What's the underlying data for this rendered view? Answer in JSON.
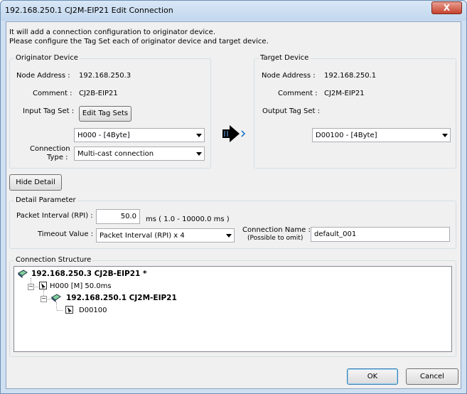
{
  "window": {
    "title": "192.168.250.1 CJ2M-EIP21 Edit Connection",
    "close_glyph": "X"
  },
  "intro": {
    "line1": "It will add a connection configuration to originator device.",
    "line2": "Please configure the Tag Set each of originator device and target device."
  },
  "originator": {
    "legend": "Originator Device",
    "node_address_label": "Node Address :",
    "node_address": "192.168.250.3",
    "comment_label": "Comment :",
    "comment": "CJ2B-EIP21",
    "input_tag_set_label": "Input Tag Set :",
    "edit_tag_sets_button": "Edit Tag Sets",
    "input_tag_set": "H000 - [4Byte]",
    "connection_type_label_1": "Connection",
    "connection_type_label_2": "Type :",
    "connection_type": "Multi-cast connection"
  },
  "target": {
    "legend": "Target Device",
    "node_address_label": "Node Address :",
    "node_address": "192.168.250.1",
    "comment_label": "Comment :",
    "comment": "CJ2M-EIP21",
    "output_tag_set_label": "Output Tag Set :",
    "output_tag_set": "D00100 - [4Byte]"
  },
  "hide_detail_button": "Hide Detail",
  "detail": {
    "legend": "Detail Parameter",
    "packet_interval_label": "Packet Interval (RPI) :",
    "packet_interval": "50.0",
    "packet_interval_range": "ms ( 1.0 - 10000.0 ms )",
    "timeout_label": "Timeout Value :",
    "timeout_value": "Packet Interval (RPI) x 4",
    "connection_name_label_1": "Connection Name :",
    "connection_name_label_2": "(Possible to omit)",
    "connection_name": "default_001"
  },
  "structure": {
    "legend": "Connection Structure",
    "originator_node": "192.168.250.3 CJ2B-EIP21 *",
    "input_tag": "H000 [M] 50.0ms",
    "target_node": "192.168.250.1 CJ2M-EIP21",
    "output_tag": "D00100"
  },
  "buttons": {
    "ok": "OK",
    "cancel": "Cancel"
  }
}
